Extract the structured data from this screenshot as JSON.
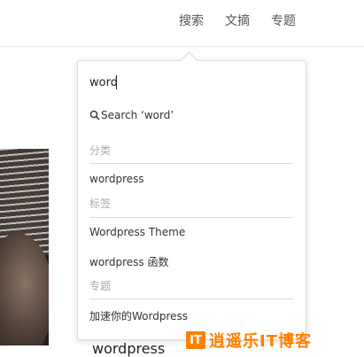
{
  "nav": {
    "items": [
      {
        "label": "搜索"
      },
      {
        "label": "文摘"
      },
      {
        "label": "专题"
      }
    ]
  },
  "search": {
    "value": "word",
    "suggestion": "Search ‘word’"
  },
  "sections": {
    "category": {
      "label": "分类",
      "items": [
        "wordpress"
      ]
    },
    "tags": {
      "label": "标签",
      "items": [
        "Wordpress Theme",
        "wordpress 函数"
      ]
    },
    "topics": {
      "label": "专题",
      "items": [
        "加速你的Wordpress"
      ]
    }
  },
  "background": {
    "post_title": "wordpress"
  },
  "watermark": {
    "logo": "IT",
    "text": "逍遥乐IT博客"
  },
  "colors": {
    "accent": "#ff7f00",
    "muted": "#aaaaaa",
    "divider": "#dcdcdc"
  }
}
